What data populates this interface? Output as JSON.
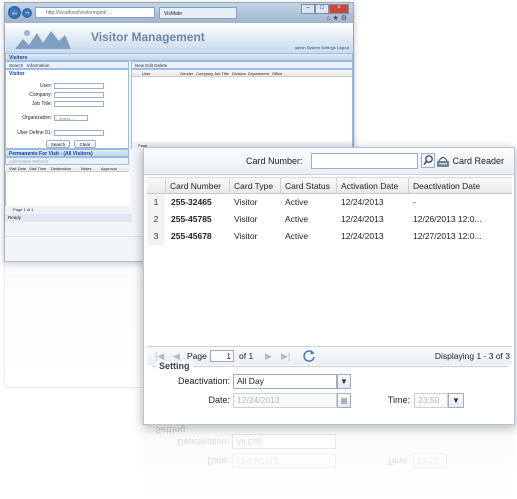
{
  "browser": {
    "address": "http://localhost/visitormgmt/ ... ",
    "tab_title": "VisMate",
    "app_title": "Visitor Management",
    "toplinks": "admin   System Settings   Logout",
    "panel_title": "Visitors",
    "left_tabs": [
      "Search",
      "Information"
    ],
    "search_section": "Visitor",
    "search_fields": [
      "User:",
      "Company:",
      "Job Title:",
      "Organization:",
      "User Define 01:"
    ],
    "org_select_value": "-- Select --",
    "search_btn": "Search",
    "clear_btn": "Clear",
    "right_toolbar": "New  Edit  Delete",
    "right_columns": [
      "User",
      "Gender",
      "Company",
      "Job Title",
      "Division",
      "Department",
      "Office"
    ],
    "right_pager": "Page",
    "list_title": "Permanents For Visit - (All Visitors)",
    "list_toolbar": "Add  Delete  Refresh",
    "list_columns": [
      "Visit Date",
      "Visit Time",
      "Destination",
      "Notes",
      "Approval"
    ],
    "list_pager": "Page  1  of 1",
    "status": "Ready"
  },
  "card": {
    "card_number_label": "Card Number:",
    "card_number_value": "",
    "card_reader_label": "Card Reader",
    "columns": [
      "Card Number",
      "Card Type",
      "Card Status",
      "Activation Date",
      "Deactivation Date"
    ],
    "rows": [
      {
        "n": "1",
        "number": "255-32465",
        "type": "Visitor",
        "status": "Active",
        "activation": "12/24/2013",
        "deactivation": "-"
      },
      {
        "n": "2",
        "number": "255-45785",
        "type": "Visitor",
        "status": "Active",
        "activation": "12/24/2013",
        "deactivation": "12/26/2013 12:0..."
      },
      {
        "n": "3",
        "number": "255-45678",
        "type": "Visitor",
        "status": "Active",
        "activation": "12/24/2013",
        "deactivation": "12/27/2013 12:0..."
      }
    ],
    "pager": {
      "page_label": "Page",
      "page_value": "1",
      "of_label": "of 1",
      "display": "Displaying 1 - 3 of 3"
    },
    "setting": {
      "legend": "Setting",
      "deactivation_label": "Deactivation:",
      "deactivation_value": "All Day",
      "date_label": "Date:",
      "date_value": "12/24/2013",
      "time_label": "Time:",
      "time_value": "23:50"
    }
  }
}
